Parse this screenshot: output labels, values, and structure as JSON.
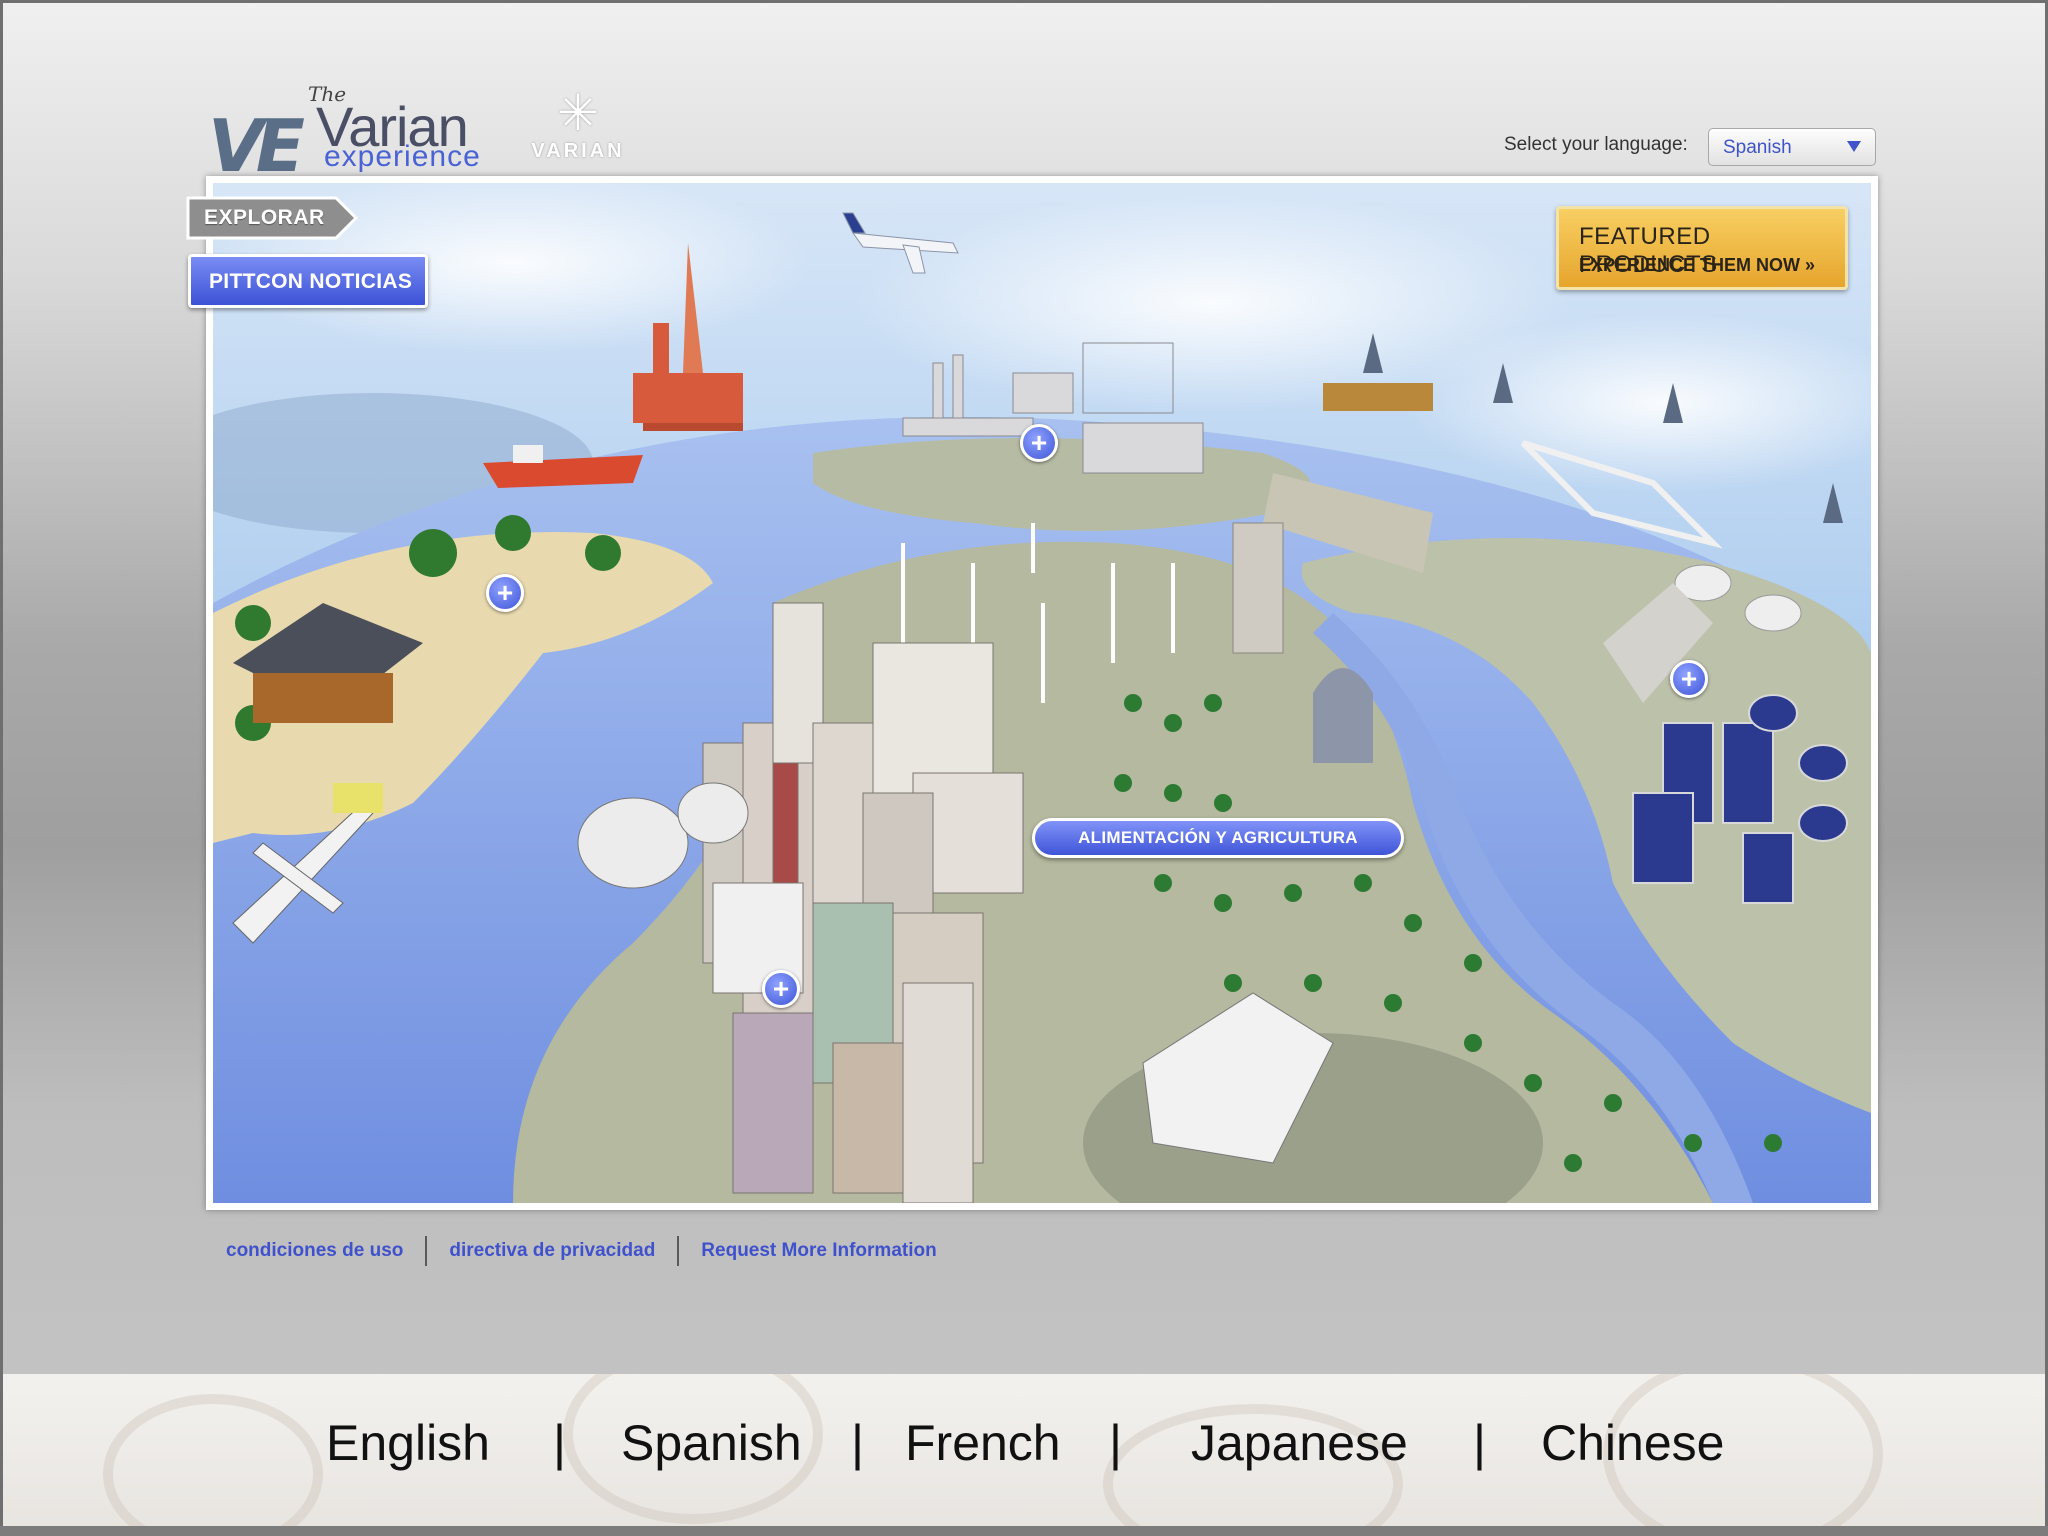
{
  "header": {
    "logo": {
      "the": "The",
      "mark": "VE",
      "name": "Varian",
      "sub": "experience"
    },
    "brand2": {
      "name": "VARIAN"
    },
    "language_label": "Select your language:",
    "language_select": {
      "value": "Spanish"
    }
  },
  "scene": {
    "explore_button": "EXPLORAR",
    "news_button": "PITTCON NOTICIAS",
    "featured": {
      "line1": "FEATURED PRODUCTS",
      "line2": "EXPERIENCE THEM NOW »"
    },
    "hotspot_label": "ALIMENTACIÓN Y AGRICULTURA",
    "hotspots": [
      "industry",
      "beach",
      "solar",
      "city"
    ]
  },
  "footer": {
    "links": [
      "condiciones de uso",
      "directiva de privacidad",
      "Request More Information"
    ]
  },
  "language_bar": {
    "items": [
      "English",
      "Spanish",
      "French",
      "Japanese",
      "Chinese"
    ],
    "separator": "|"
  },
  "colors": {
    "accent": "#3e55d6",
    "featured": "#f2bf4c",
    "sky": "#bfd7f0",
    "water": "#8aa8e6",
    "land": "#b9bea6"
  }
}
